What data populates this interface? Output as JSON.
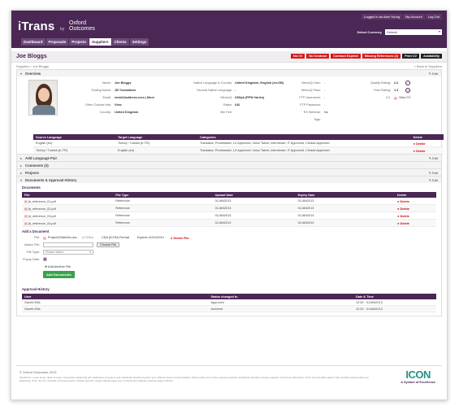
{
  "app": {
    "logo": "iTrans",
    "by": "by",
    "partner_line1": "Oxford",
    "partner_line2": "Outcomes"
  },
  "toplinks": [
    "Logged in as Alan Young",
    "My Account",
    "Log Out"
  ],
  "currency": {
    "label": "Select Currency",
    "value": "Default"
  },
  "nav": [
    "Dashboard",
    "Proposals",
    "Projects",
    "Suppliers",
    "Clients",
    "Settings"
  ],
  "active_nav": "Suppliers",
  "page_title": "Joe Bloggs",
  "actions": [
    "No CV",
    "No Contract",
    "Contract Expired",
    "Missing References (2)",
    "Print CV",
    "Availability"
  ],
  "breadcrumb": {
    "root": "Suppliers",
    "current": "Joe Bloggs",
    "back": "« Back to Suppliers"
  },
  "overview": {
    "title": "Overview",
    "edit": "Edit",
    "left_labels": [
      "Name:",
      "Trading Name:",
      "Email:",
      "Other Contact Info:",
      "Country:"
    ],
    "left_values": [
      "Joe Bloggs",
      "JB Translation",
      "email@address.com | More",
      "View",
      "United Kingdom"
    ],
    "mid_labels": [
      "Native Language & Country:",
      "Second Native Language:",
      "MemoQ:",
      "Rates:",
      "Min Fee:"
    ],
    "mid_values": [
      "United Kingdom, English (en-GB)",
      "-",
      "£35/pk (PPW Varies)",
      "£40",
      ""
    ],
    "r_labels": [
      "MemoQ User:",
      "MemoQ Pass:",
      "FTP Username:",
      "FTP Password:",
      "ES Webinar:",
      "Tags:"
    ],
    "r_values": [
      "-",
      "-",
      "-",
      "-",
      "No",
      ""
    ],
    "ratings": [
      {
        "label": "Quality Rating:",
        "value": "2.2"
      },
      {
        "label": "Time Rating:",
        "value": "1.3"
      },
      {
        "label": "CV:",
        "value": "View CV"
      }
    ]
  },
  "lang_table": {
    "headers": [
      "Source Language",
      "Target Language",
      "Categories",
      "Delete"
    ],
    "rows": [
      [
        "English (en)",
        "Turkey / Turkish (tr-TR)",
        "Translator, Proofreader, LX Approved, Voice Talent, Interviewer, IT Approved, Clinical Approved",
        "Delete"
      ],
      [
        "Turkey / Turkish (tr-TR)",
        "English (en)",
        "Translator, Proofreader, LX Approved, Voice Talent, Interviewer, IT Approved, Clinical Approved",
        "Delete"
      ]
    ]
  },
  "sections": [
    "Add Language Pair",
    "Comments (3)",
    "Projects",
    "Documents & Approval History"
  ],
  "documents": {
    "heading": "Documents",
    "headers": [
      "File",
      "File Type",
      "Upload Date",
      "Expiry Date",
      "Delete"
    ],
    "rows": [
      [
        "jb_reference_01.pdf",
        "Reference",
        "01JAN2013",
        "01JAN2013",
        "Delete"
      ],
      [
        "jb_reference_02.pdf",
        "Reference",
        "01JAN2013",
        "01JAN2013",
        "Delete"
      ],
      [
        "jb_reference_03.pdf",
        "Reference",
        "01JAN2013",
        "01JAN2013",
        "Delete"
      ],
      [
        "jb_reference_04.pdf",
        "Reference",
        "01JAN2013",
        "01JAN2013",
        "Delete"
      ]
    ],
    "add_heading": "Add a Document",
    "file_label": "File:",
    "file_name": "Project123ab45c.doc",
    "file_size": "(2.00kb)",
    "file_type_text": "CDA (ICON) Format",
    "expires_text": "Expires 01/01/2014",
    "delete_file": "Delete File",
    "attach_label": "Attach File:",
    "choose_file": "Choose File",
    "type_label": "File Type:",
    "type_placeholder": "Please Select",
    "expiry_label": "Expiry Date:",
    "add_another": "Add Another File",
    "add_button": "Add Documents"
  },
  "approval": {
    "heading": "Approval History",
    "headers": [
      "User",
      "Status changed to",
      "Date & Time"
    ],
    "rows": [
      [
        "Gareth Ellis",
        "Approved",
        "12:30 · 01JAN2013"
      ],
      [
        "Gareth Ellis",
        "Archived",
        "12:30 · 01JAN2013"
      ]
    ]
  },
  "footer": {
    "copy": "© Oxford Outcomes 2013",
    "disclaimer": "Disclaimer: Lorem ipsum dolor sit amet, consectetur adipiscing elit. Vestibulum a turpis et velit sollicitudin lobortis id auctor sem. Mauris viverra ornare faucibus. Morbi mollis orci et tortor posuere pulvinar. Vestibulum interdum semper egestas. Ut rhoncus nibh ipsum. Proin sed convallis mauris. Nam faucibus aliquet tellus nec adipiscing. Proin nec dui, vehicula ut rhoncus sanim, facilisis sed elit. Integer blandit augue sem condimentum aliquam pulvinar augue ultricies.",
    "logo": "ICON",
    "tagline": "A Symbol of Excellence"
  },
  "colors": {
    "brand": "#4a2754",
    "alert": "#d21c1c",
    "success": "#3aa24b",
    "icon_logo": "#2a8f8a"
  }
}
